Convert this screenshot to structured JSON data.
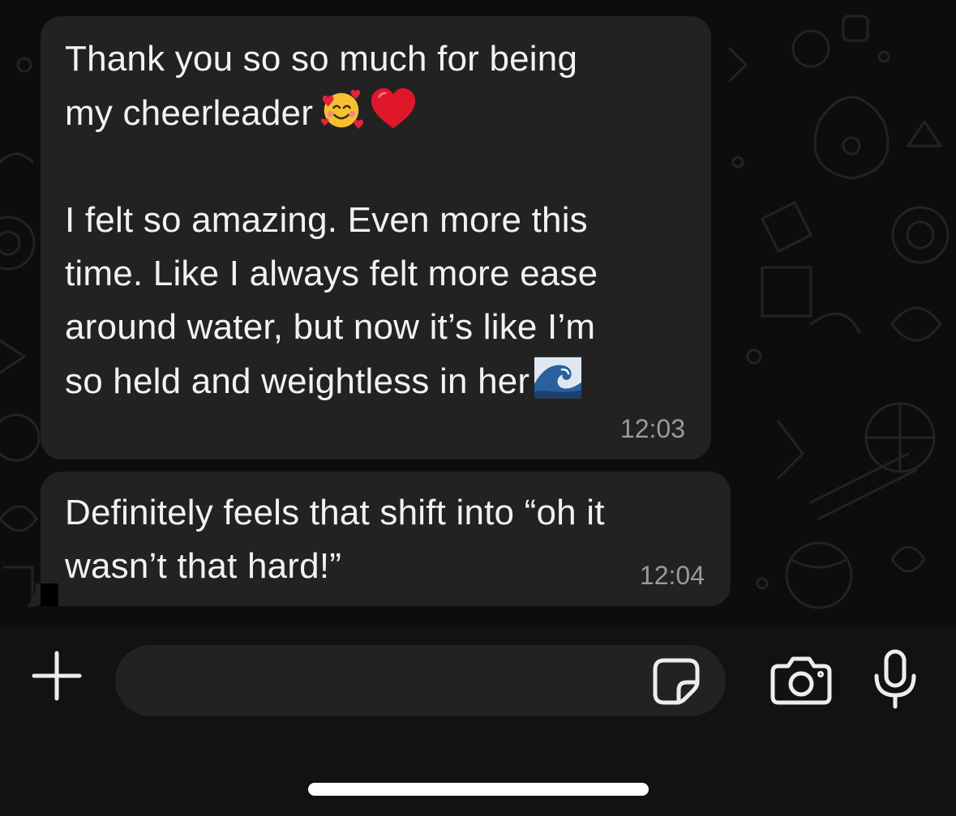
{
  "messages": [
    {
      "line1": "Thank you so so much for being",
      "line2": "my cheerleader",
      "body": "I felt so amazing. Even more this\ntime. Like I always felt more ease\naround water, but now it’s like I’m\nso held and weightless in her",
      "time": "12:03",
      "emojis": [
        "smiling-face-with-hearts",
        "red-heart",
        "water-wave"
      ]
    },
    {
      "text": "Definitely feels that shift into “oh it\nwasn’t that hard!”",
      "time": "12:04"
    }
  ],
  "composer": {
    "input_value": "",
    "icons": [
      "plus-icon",
      "sticker-icon",
      "camera-icon",
      "microphone-icon"
    ]
  },
  "colors": {
    "bubble": "#222222",
    "background": "#0d0d0d",
    "text": "#f2f2f2",
    "timestamp": "#9a9a9a"
  }
}
